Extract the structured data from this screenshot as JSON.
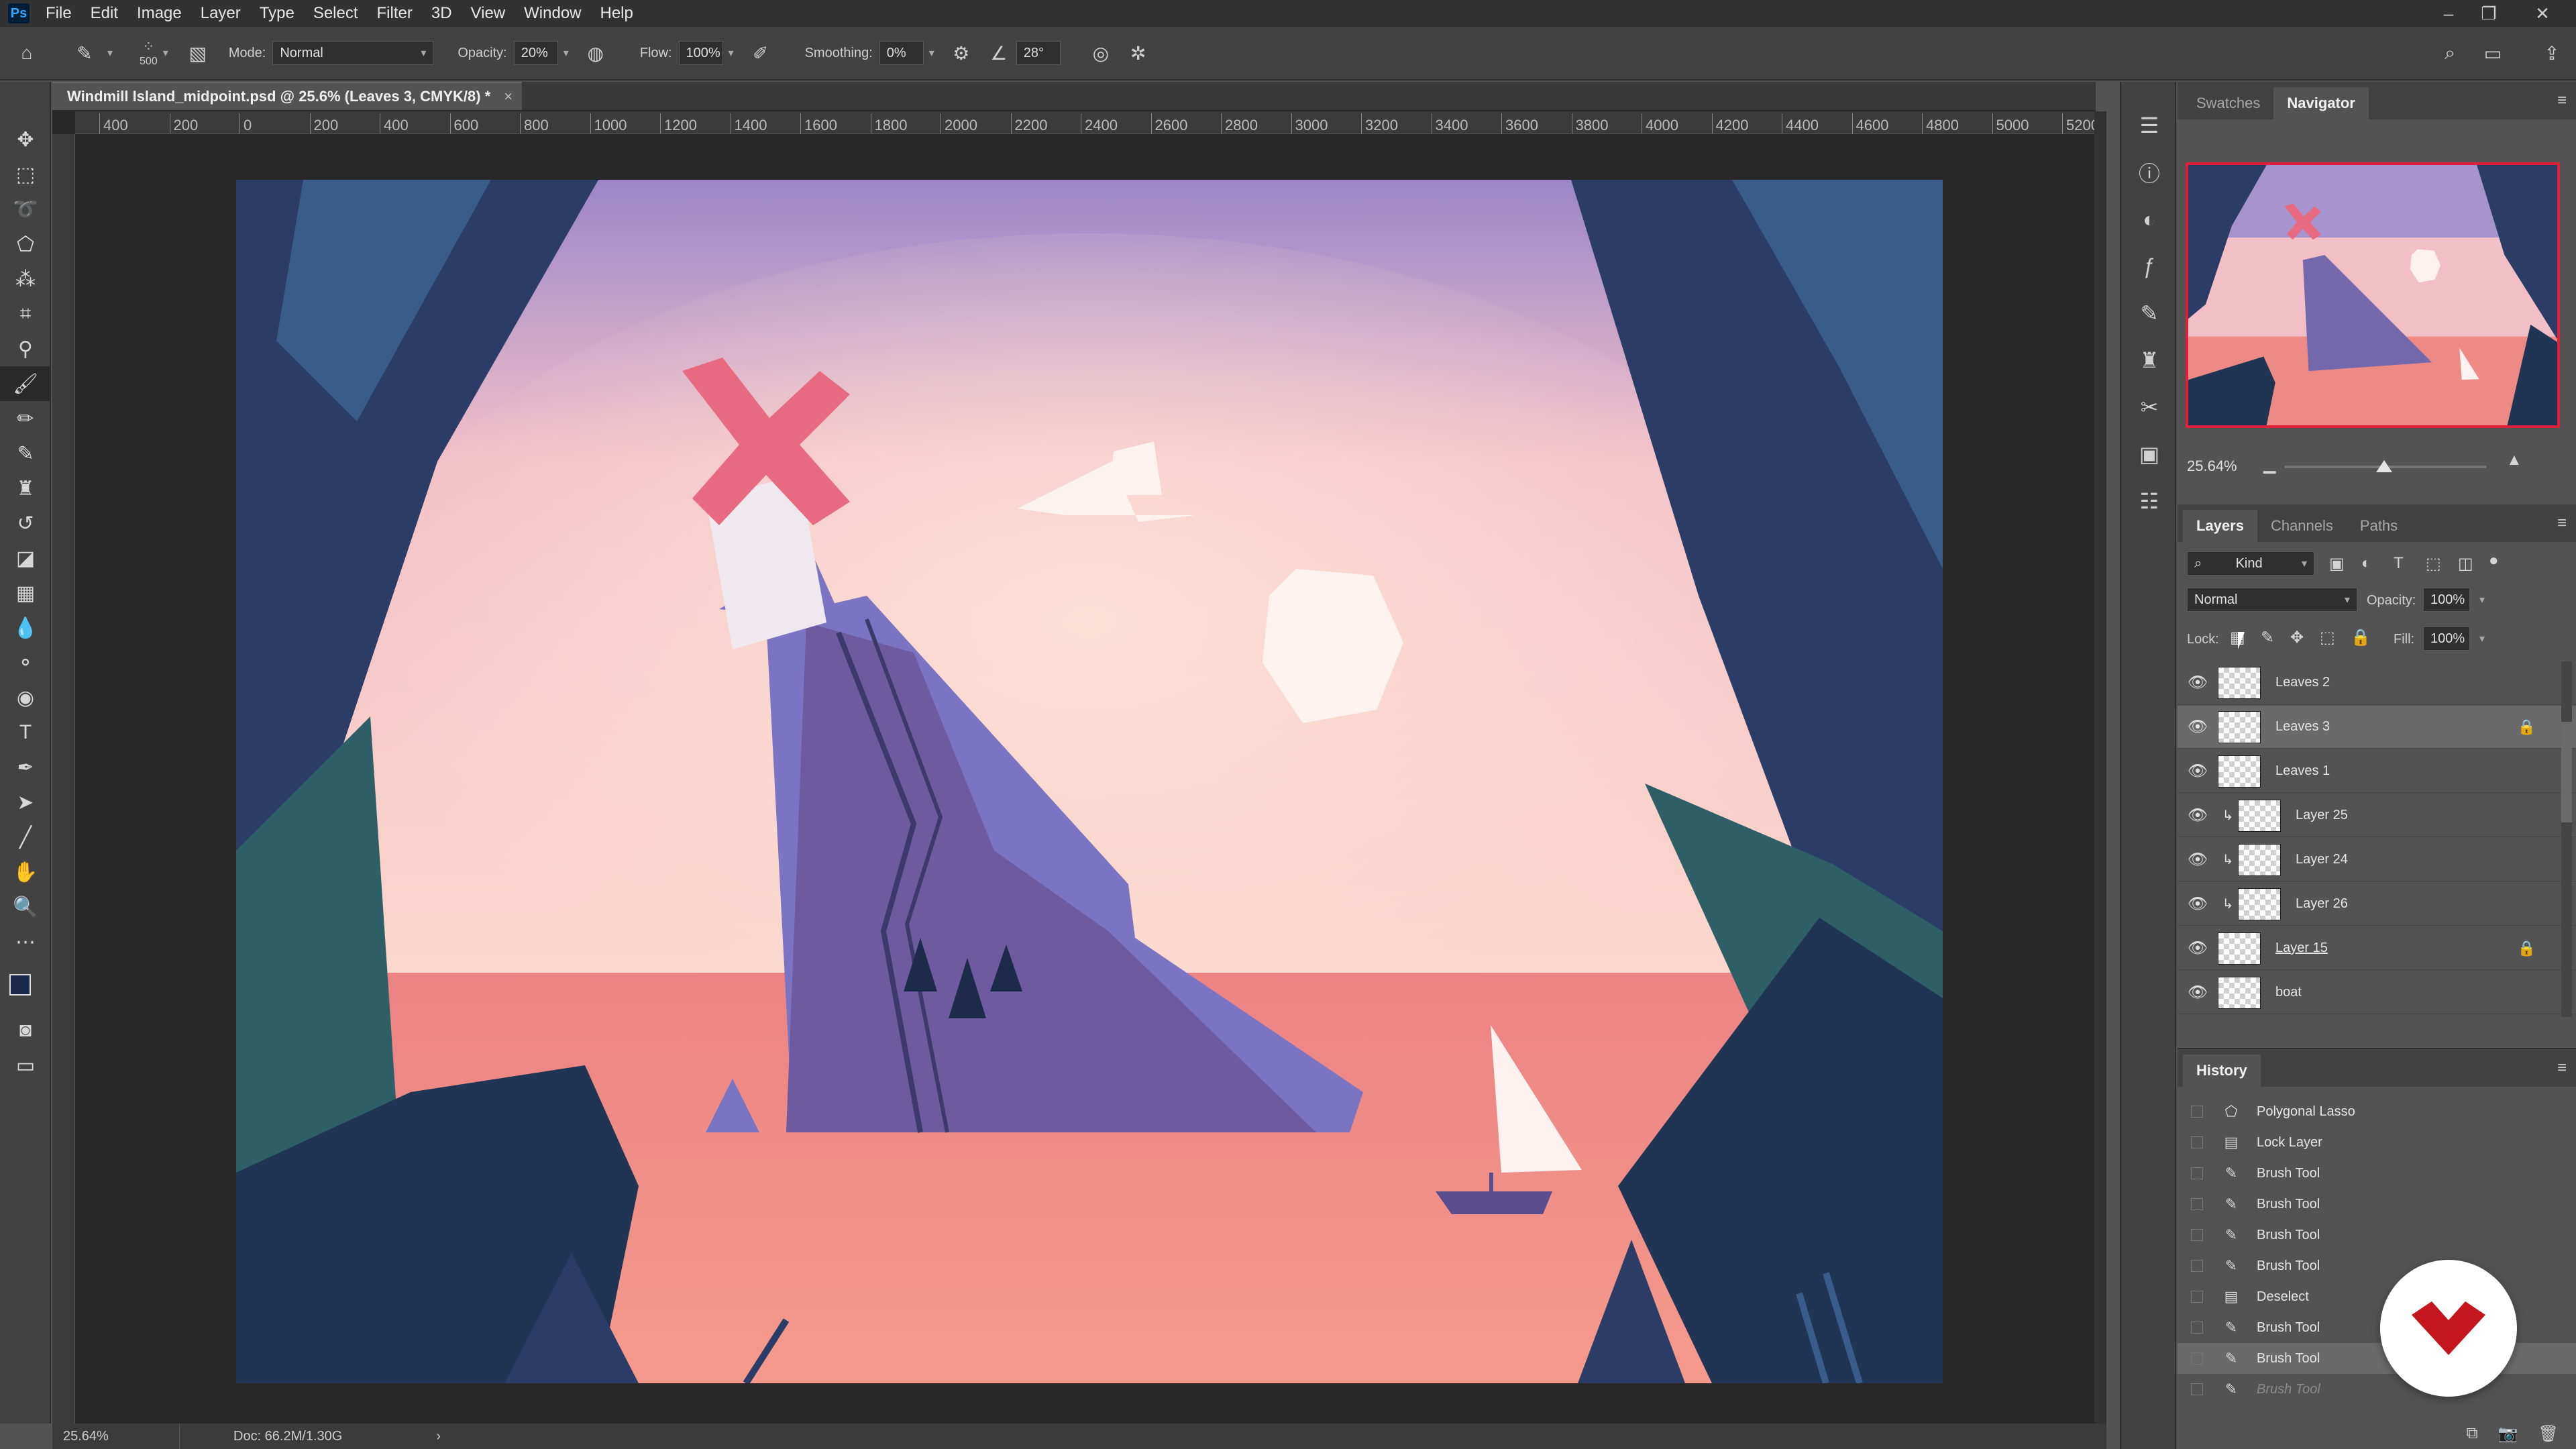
{
  "app": {
    "logo": "Ps",
    "menu": [
      "File",
      "Edit",
      "Image",
      "Layer",
      "Type",
      "Select",
      "Filter",
      "3D",
      "View",
      "Window",
      "Help"
    ]
  },
  "options": {
    "brush_size": "500",
    "mode_label": "Mode:",
    "mode_value": "Normal",
    "opacity_label": "Opacity:",
    "opacity_value": "20%",
    "flow_label": "Flow:",
    "flow_value": "100%",
    "smoothing_label": "Smoothing:",
    "smoothing_value": "0%",
    "angle_value": "28°"
  },
  "document": {
    "tab_title": "Windmill Island_midpoint.psd @ 25.6% (Leaves 3, CMYK/8) *",
    "close_glyph": "×",
    "ruler_labels": [
      "400",
      "200",
      "0",
      "200",
      "400",
      "600",
      "800",
      "1000",
      "1200",
      "1400",
      "1600",
      "1800",
      "2000",
      "2200",
      "2400",
      "2600",
      "2800",
      "3000",
      "3200",
      "3400",
      "3600",
      "3800",
      "4000",
      "4200",
      "4400",
      "4600",
      "4800",
      "5000",
      "5200"
    ]
  },
  "status": {
    "zoom": "25.64%",
    "doc_size": "Doc: 66.2M/1.30G",
    "arrow": "›"
  },
  "navigator": {
    "tabs": [
      "Swatches",
      "Navigator"
    ],
    "active_tab": "Navigator",
    "zoom": "25.64%"
  },
  "layers_panel": {
    "tabs": [
      "Layers",
      "Channels",
      "Paths"
    ],
    "active_tab": "Layers",
    "filter_kind": "Kind",
    "blend_mode": "Normal",
    "opacity_label": "Opacity:",
    "opacity_value": "100%",
    "lock_label": "Lock:",
    "fill_label": "Fill:",
    "fill_value": "100%",
    "layers": [
      {
        "name": "Leaves 2",
        "clipped": false,
        "locked": false,
        "selected": false
      },
      {
        "name": "Leaves 3",
        "clipped": false,
        "locked": true,
        "selected": true
      },
      {
        "name": "Leaves 1",
        "clipped": false,
        "locked": false,
        "selected": false
      },
      {
        "name": "Layer 25",
        "clipped": true,
        "locked": false,
        "selected": false
      },
      {
        "name": "Layer 24",
        "clipped": true,
        "locked": false,
        "selected": false
      },
      {
        "name": "Layer 26",
        "clipped": true,
        "locked": false,
        "selected": false
      },
      {
        "name": "Layer 15",
        "clipped": false,
        "locked": true,
        "selected": false
      },
      {
        "name": "boat",
        "clipped": false,
        "locked": false,
        "selected": false
      }
    ]
  },
  "history_panel": {
    "title": "History",
    "items": [
      {
        "label": "Polygonal Lasso",
        "icon": "lasso-icon",
        "state": "normal"
      },
      {
        "label": "Lock Layer",
        "icon": "document-icon",
        "state": "normal"
      },
      {
        "label": "Brush Tool",
        "icon": "brush-icon",
        "state": "normal"
      },
      {
        "label": "Brush Tool",
        "icon": "brush-icon",
        "state": "normal"
      },
      {
        "label": "Brush Tool",
        "icon": "brush-icon",
        "state": "normal"
      },
      {
        "label": "Brush Tool",
        "icon": "brush-icon",
        "state": "normal"
      },
      {
        "label": "Deselect",
        "icon": "document-icon",
        "state": "normal"
      },
      {
        "label": "Brush Tool",
        "icon": "brush-icon",
        "state": "normal"
      },
      {
        "label": "Brush Tool",
        "icon": "brush-icon",
        "state": "selected"
      },
      {
        "label": "Brush Tool",
        "icon": "brush-icon",
        "state": "undone"
      }
    ]
  },
  "colors": {
    "sky_top": "#9b86c9",
    "sky_mid": "#f6cbc6",
    "sea": "#ef8a86",
    "cliff": "#7a68ae",
    "leaves_dark": "#2b3d66",
    "leaves_teal": "#2e5e66",
    "windmill_blades": "#e76a80",
    "accent_red": "#e0203a"
  }
}
